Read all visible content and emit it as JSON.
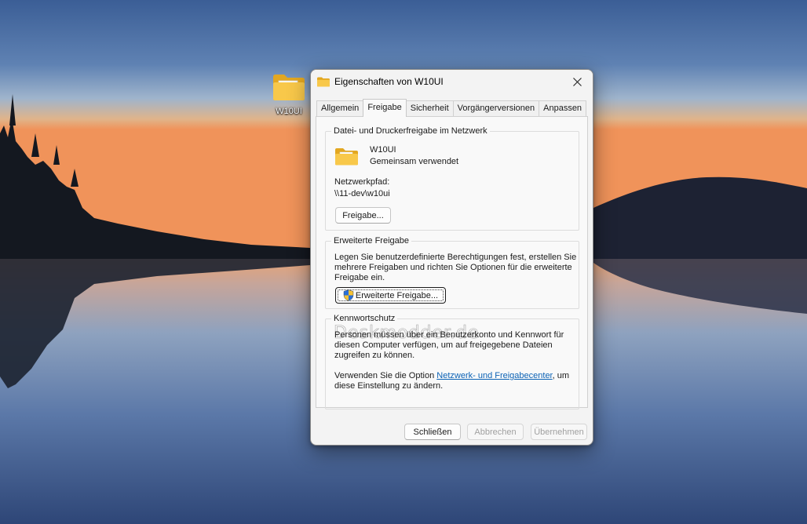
{
  "desktop": {
    "icon_label": "W10UI"
  },
  "dialog": {
    "title": "Eigenschaften von W10UI",
    "tabs": [
      {
        "label": "Allgemein",
        "active": false
      },
      {
        "label": "Freigabe",
        "active": true
      },
      {
        "label": "Sicherheit",
        "active": false
      },
      {
        "label": "Vorgängerversionen",
        "active": false
      },
      {
        "label": "Anpassen",
        "active": false
      }
    ],
    "network_share": {
      "group_title": "Datei- und Druckerfreigabe im Netzwerk",
      "folder_name": "W10UI",
      "status": "Gemeinsam verwendet",
      "path_label": "Netzwerkpfad:",
      "path_value": "\\\\11-dev\\w10ui",
      "share_button": "Freigabe..."
    },
    "advanced_share": {
      "group_title": "Erweiterte Freigabe",
      "description_line1": "Legen Sie benutzerdefinierte Berechtigungen fest, erstellen Sie",
      "description_line2": "mehrere Freigaben und richten Sie Optionen für die erweiterte",
      "description_line3": "Freigabe ein.",
      "button": "Erweiterte Freigabe...",
      "watermark": "Deskmodder.de"
    },
    "password_protection": {
      "group_title": "Kennwortschutz",
      "text_line1": "Personen müssen über ein Benutzerkonto und Kennwort für",
      "text_line2": "diesen Computer verfügen, um auf freigegebene Dateien",
      "text_line3": "zugreifen zu können.",
      "option_prefix": "Verwenden Sie die Option ",
      "option_link": "Netzwerk- und Freigabecenter",
      "option_suffix": ", um",
      "option_line2": "diese Einstellung zu ändern."
    },
    "footer": {
      "close_button": "Schließen",
      "cancel_button": "Abbrechen",
      "apply_button": "Übernehmen"
    }
  },
  "colors": {
    "folder_yellow": "#f6c343",
    "link_blue": "#0b62b5",
    "dialog_bg": "#f3f3f3"
  }
}
